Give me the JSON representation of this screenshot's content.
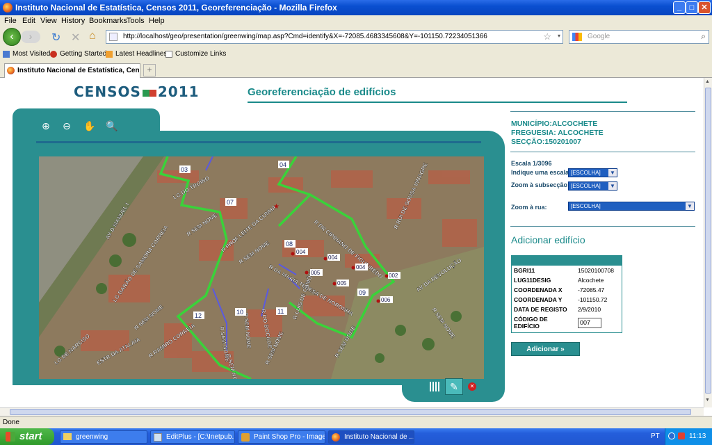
{
  "window": {
    "title": "Instituto Nacional de Estatística, Censos 2011, Georeferenciação - Mozilla Firefox"
  },
  "menu": [
    "File",
    "Edit",
    "View",
    "History",
    "Bookmarks",
    "Tools",
    "Help"
  ],
  "nav": {
    "url": "http://localhost/geo/presentation/greenwing/map.asp?Cmd=identify&X=-72085.4683345608&Y=-101150.72234051366",
    "search_placeholder": "Google"
  },
  "bookmarks": [
    "Most Visited",
    "Getting Started",
    "Latest Headlines",
    "Customize Links"
  ],
  "tab": {
    "label": "Instituto Nacional de Estatística, Cen...",
    "new": "+"
  },
  "page": {
    "logo_a": "CENSOS",
    "logo_b": "2011",
    "title": "Georeferenciação de edifícios",
    "municipio": "MUNICÍPIO:ALCOCHETE",
    "freguesia": "FREGUESIA: ALCOCHETE",
    "seccao": "SECÇÃO:150201007",
    "escala": "Escala 1/3096",
    "escala_label": "Indique uma escala:",
    "escala_sel": "[ESCOLHA]",
    "subseccao_label": "Zoom à subsecção:",
    "subseccao_sel": "[ESCOLHA]",
    "rua_label": "Zoom à rua:",
    "rua_sel": "[ESCOLHA]",
    "add_title": "Adicionar edifício",
    "attrs": [
      {
        "k": "BGRI11",
        "v": "15020100708"
      },
      {
        "k": "LUG11DESIG",
        "v": "Alcochete"
      },
      {
        "k": "COORDENADA X",
        "v": "-72085.47"
      },
      {
        "k": "COORDENADA Y",
        "v": "-101150.72"
      },
      {
        "k": "DATA DE REGISTO",
        "v": "2/9/2010"
      },
      {
        "k": "CÓDIGO DE EDIFÍCIO",
        "v": "007"
      }
    ],
    "add_button": "Adicionar »",
    "tools": [
      "zoom-in-icon",
      "zoom-out-icon",
      "pan-hand-icon",
      "identify-icon"
    ]
  },
  "map": {
    "streets": [
      "AV D MANUEL I",
      "LG DO TROINO",
      "R SEM NOME",
      "R PROF LEITE DA CUNHA",
      "R DR CIPRIANO DE FIGUEIREDO",
      "R RUI DE SOUSA VINAGRE",
      "LG BARÃO DE SAMORA CORREIA",
      "R SEM NOME",
      "R DA MARIA TERESA DE NORONHA",
      "AV DA REVOLUÇÃO",
      "R SEM NOME",
      "R SEM NOME",
      "R SEM NOME",
      "R DO BOCAGE",
      "R LUIS DE CAMÕES",
      "R SEM NOME",
      "LG DE NARCISO",
      "ESTR DA ATALAIA",
      "R RAMIRO CORREIA",
      "R SEM NOME",
      "R SEM NOME",
      "R SEM NOME"
    ],
    "sections": [
      "03",
      "04",
      "07",
      "08",
      "09",
      "10",
      "11",
      "12"
    ],
    "points": [
      "004",
      "004",
      "004",
      "005",
      "005",
      "002",
      "006"
    ]
  },
  "status": "Done",
  "taskbar": {
    "start": "start",
    "items": [
      "greenwing",
      "EditPlus - [C:\\Inetpub...",
      "Paint Shop Pro - Image1",
      "Instituto Nacional de ..."
    ],
    "lang": "PT",
    "time": "11:13"
  }
}
